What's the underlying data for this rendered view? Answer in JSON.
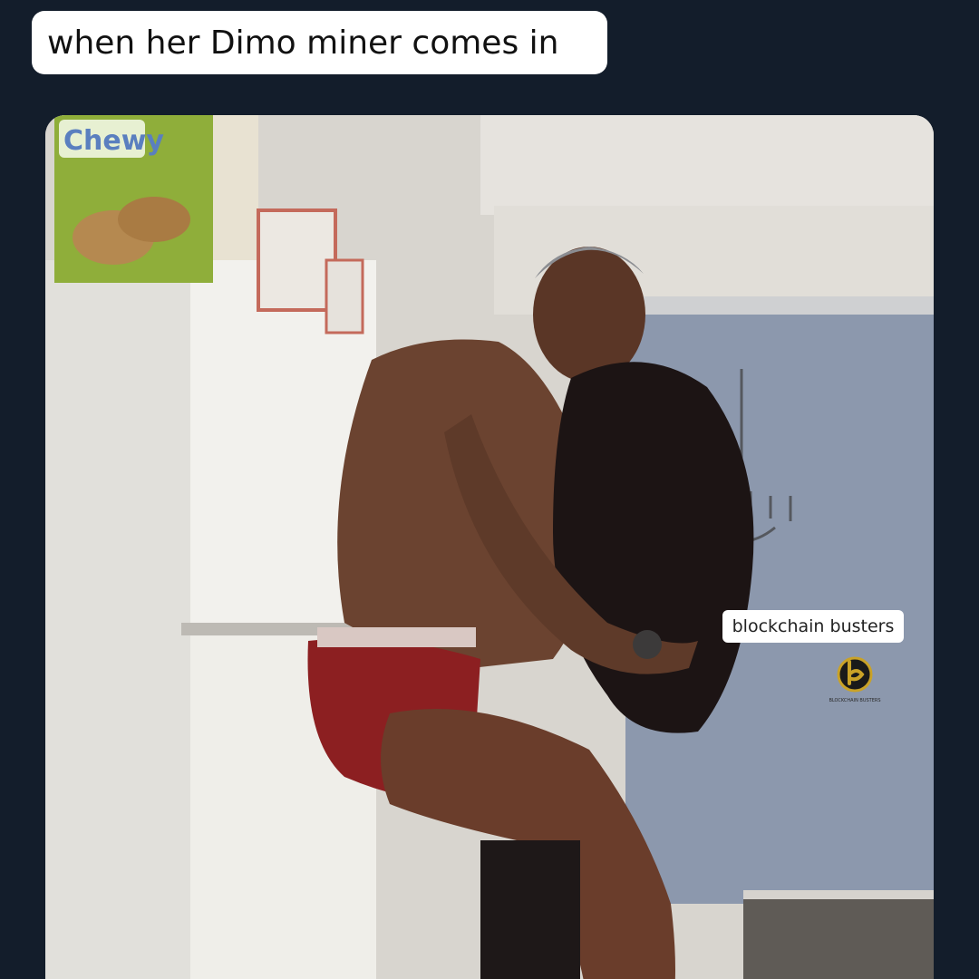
{
  "caption": {
    "text": "when her Dimo miner comes in"
  },
  "photo": {
    "box_brand": "Chewy"
  },
  "watermark": {
    "label": "blockchain busters",
    "logo_icon": "blockchain-busters-logo-icon",
    "logo_small_text": "BLOCKCHAIN BUSTERS"
  },
  "colors": {
    "background": "#131d2b",
    "bubble": "#ffffff",
    "logo_gold": "#c9a227"
  }
}
